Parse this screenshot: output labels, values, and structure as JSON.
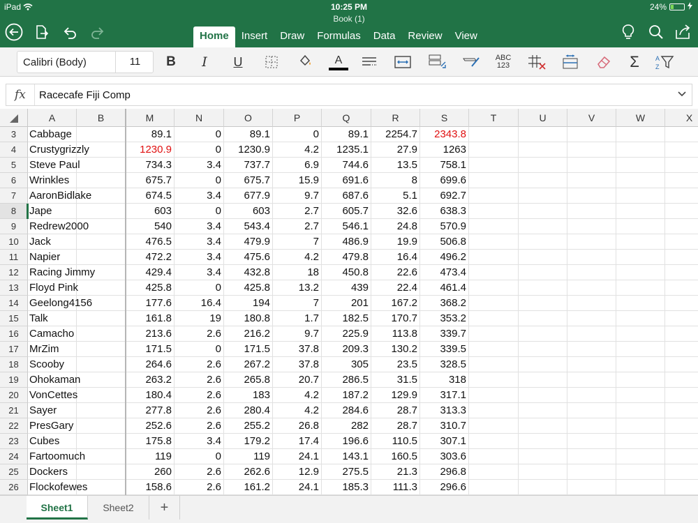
{
  "status_bar": {
    "device": "iPad",
    "time": "10:25 PM",
    "battery": "24%",
    "battery_level": 0.24
  },
  "document": {
    "title": "Book (1)"
  },
  "header": {
    "tabs": [
      {
        "label": "Home",
        "active": true
      },
      {
        "label": "Insert",
        "active": false
      },
      {
        "label": "Draw",
        "active": false
      },
      {
        "label": "Formulas",
        "active": false
      },
      {
        "label": "Data",
        "active": false
      },
      {
        "label": "Review",
        "active": false
      },
      {
        "label": "View",
        "active": false
      }
    ],
    "brand_color": "#217346"
  },
  "ribbon": {
    "font_name": "Calibri (Body)",
    "font_size": "11",
    "number_format_label": "ABC 123"
  },
  "formula_bar": {
    "fx_label": "fx",
    "value": "Racecafe Fiji Comp"
  },
  "grid": {
    "columns": [
      "A",
      "B",
      "M",
      "N",
      "O",
      "P",
      "Q",
      "R",
      "S",
      "T",
      "U",
      "V",
      "W",
      "X"
    ],
    "selected_row": "8",
    "rows": [
      {
        "row": "3",
        "name": "Cabbage",
        "values": [
          "89.1",
          "0",
          "89.1",
          "0",
          "89.1",
          "2254.7",
          "2343.8"
        ],
        "red": [
          6
        ]
      },
      {
        "row": "4",
        "name": "Crustygrizzly",
        "values": [
          "1230.9",
          "0",
          "1230.9",
          "4.2",
          "1235.1",
          "27.9",
          "1263"
        ],
        "red": [
          0
        ]
      },
      {
        "row": "5",
        "name": "Steve Paul",
        "values": [
          "734.3",
          "3.4",
          "737.7",
          "6.9",
          "744.6",
          "13.5",
          "758.1"
        ],
        "red": []
      },
      {
        "row": "6",
        "name": "Wrinkles",
        "values": [
          "675.7",
          "0",
          "675.7",
          "15.9",
          "691.6",
          "8",
          "699.6"
        ],
        "red": []
      },
      {
        "row": "7",
        "name": "AaronBidlake",
        "values": [
          "674.5",
          "3.4",
          "677.9",
          "9.7",
          "687.6",
          "5.1",
          "692.7"
        ],
        "red": []
      },
      {
        "row": "8",
        "name": "Jape",
        "values": [
          "603",
          "0",
          "603",
          "2.7",
          "605.7",
          "32.6",
          "638.3"
        ],
        "red": []
      },
      {
        "row": "9",
        "name": "Redrew2000",
        "values": [
          "540",
          "3.4",
          "543.4",
          "2.7",
          "546.1",
          "24.8",
          "570.9"
        ],
        "red": []
      },
      {
        "row": "10",
        "name": "Jack",
        "values": [
          "476.5",
          "3.4",
          "479.9",
          "7",
          "486.9",
          "19.9",
          "506.8"
        ],
        "red": []
      },
      {
        "row": "11",
        "name": "Napier",
        "values": [
          "472.2",
          "3.4",
          "475.6",
          "4.2",
          "479.8",
          "16.4",
          "496.2"
        ],
        "red": []
      },
      {
        "row": "12",
        "name": "Racing Jimmy",
        "values": [
          "429.4",
          "3.4",
          "432.8",
          "18",
          "450.8",
          "22.6",
          "473.4"
        ],
        "red": []
      },
      {
        "row": "13",
        "name": "Floyd Pink",
        "values": [
          "425.8",
          "0",
          "425.8",
          "13.2",
          "439",
          "22.4",
          "461.4"
        ],
        "red": []
      },
      {
        "row": "14",
        "name": "Geelong4156",
        "values": [
          "177.6",
          "16.4",
          "194",
          "7",
          "201",
          "167.2",
          "368.2"
        ],
        "red": []
      },
      {
        "row": "15",
        "name": "Talk",
        "values": [
          "161.8",
          "19",
          "180.8",
          "1.7",
          "182.5",
          "170.7",
          "353.2"
        ],
        "red": []
      },
      {
        "row": "16",
        "name": "Camacho",
        "values": [
          "213.6",
          "2.6",
          "216.2",
          "9.7",
          "225.9",
          "113.8",
          "339.7"
        ],
        "red": []
      },
      {
        "row": "17",
        "name": "MrZim",
        "values": [
          "171.5",
          "0",
          "171.5",
          "37.8",
          "209.3",
          "130.2",
          "339.5"
        ],
        "red": []
      },
      {
        "row": "18",
        "name": "Scooby",
        "values": [
          "264.6",
          "2.6",
          "267.2",
          "37.8",
          "305",
          "23.5",
          "328.5"
        ],
        "red": []
      },
      {
        "row": "19",
        "name": "Ohokaman",
        "values": [
          "263.2",
          "2.6",
          "265.8",
          "20.7",
          "286.5",
          "31.5",
          "318"
        ],
        "red": []
      },
      {
        "row": "20",
        "name": "VonCettes",
        "values": [
          "180.4",
          "2.6",
          "183",
          "4.2",
          "187.2",
          "129.9",
          "317.1"
        ],
        "red": []
      },
      {
        "row": "21",
        "name": "Sayer",
        "values": [
          "277.8",
          "2.6",
          "280.4",
          "4.2",
          "284.6",
          "28.7",
          "313.3"
        ],
        "red": []
      },
      {
        "row": "22",
        "name": "PresGary",
        "values": [
          "252.6",
          "2.6",
          "255.2",
          "26.8",
          "282",
          "28.7",
          "310.7"
        ],
        "red": []
      },
      {
        "row": "23",
        "name": "Cubes",
        "values": [
          "175.8",
          "3.4",
          "179.2",
          "17.4",
          "196.6",
          "110.5",
          "307.1"
        ],
        "red": []
      },
      {
        "row": "24",
        "name": "Fartoomuch",
        "values": [
          "119",
          "0",
          "119",
          "24.1",
          "143.1",
          "160.5",
          "303.6"
        ],
        "red": []
      },
      {
        "row": "25",
        "name": "Dockers",
        "values": [
          "260",
          "2.6",
          "262.6",
          "12.9",
          "275.5",
          "21.3",
          "296.8"
        ],
        "red": []
      },
      {
        "row": "26",
        "name": "Flockofewes",
        "values": [
          "158.6",
          "2.6",
          "161.2",
          "24.1",
          "185.3",
          "111.3",
          "296.6"
        ],
        "red": []
      }
    ],
    "red_color": "#e01010"
  },
  "sheets": [
    {
      "label": "Sheet1",
      "active": true
    },
    {
      "label": "Sheet2",
      "active": false
    }
  ],
  "add_sheet_label": "+"
}
